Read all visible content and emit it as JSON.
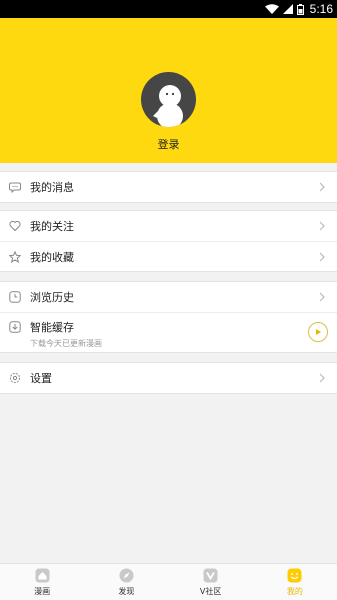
{
  "status_bar": {
    "time": "5:16"
  },
  "profile": {
    "login_label": "登录"
  },
  "menu": {
    "messages": "我的消息",
    "follows": "我的关注",
    "favorites": "我的收藏",
    "history": "浏览历史",
    "cache": {
      "label": "智能缓存",
      "subtitle": "下载今天已更新漫画"
    },
    "settings": "设置"
  },
  "tabs": [
    {
      "label": "漫画",
      "icon": "house-icon"
    },
    {
      "label": "发现",
      "icon": "compass-icon"
    },
    {
      "label": "V社区",
      "icon": "v-community-icon"
    },
    {
      "label": "我的",
      "icon": "smiley-icon"
    }
  ],
  "colors": {
    "accent": "#ffd90f",
    "active_tab": "#e6b800",
    "avatar_bg": "#464646"
  }
}
